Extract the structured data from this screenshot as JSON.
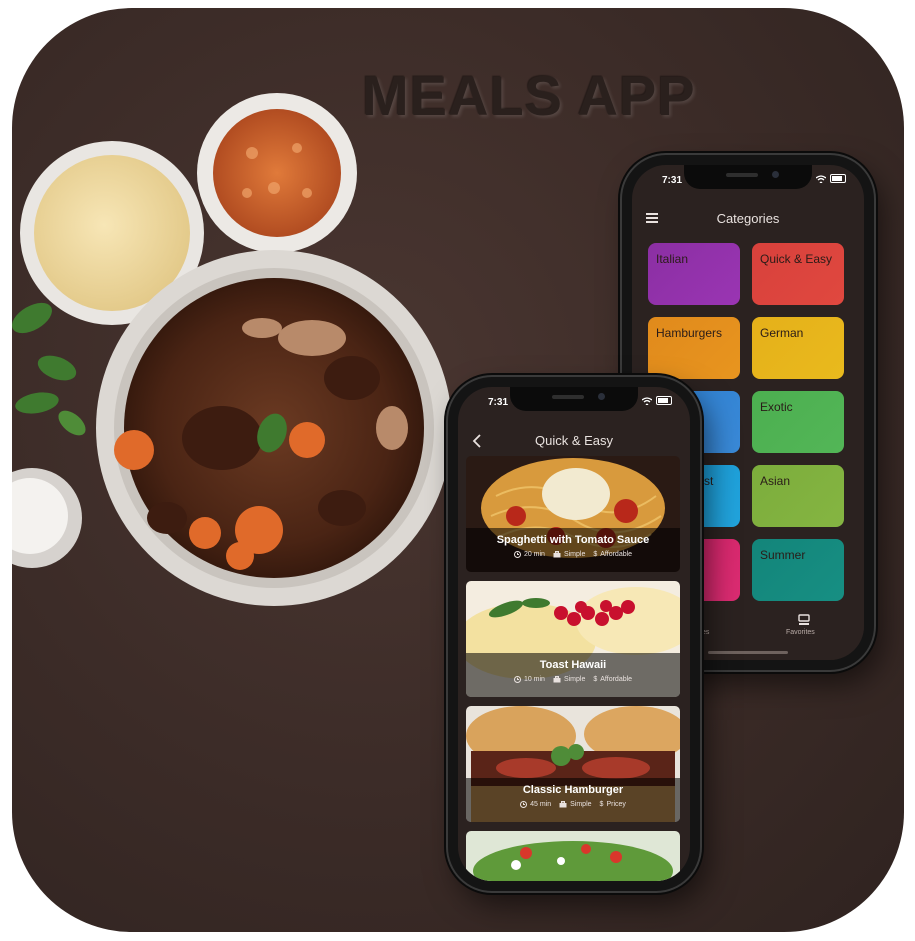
{
  "title": "MEALS APP",
  "categories_screen": {
    "status_time": "7:31",
    "title": "Categories",
    "categories": [
      {
        "label": "Italian",
        "color": "#8b2fa3"
      },
      {
        "label": "Quick & Easy",
        "color": "#d8413c"
      },
      {
        "label": "Hamburgers",
        "color": "#e08a1c"
      },
      {
        "label": "German",
        "color": "#e5b01a"
      },
      {
        "label": "",
        "color": "#2f80d1"
      },
      {
        "label": "Exotic",
        "color": "#4caf50"
      },
      {
        "label": "st",
        "color": "#1a9bd6"
      },
      {
        "label": "Asian",
        "color": "#7cad3c"
      },
      {
        "label": "",
        "color": "#d32469"
      },
      {
        "label": "Summer",
        "color": "#13857a"
      }
    ],
    "tabs": {
      "left_partial": "es",
      "favorites": "Favorites"
    }
  },
  "quick_easy_screen": {
    "status_time": "7:31",
    "title": "Quick & Easy",
    "meals": [
      {
        "title": "Spaghetti with Tomato Sauce",
        "duration": "20 min",
        "complexity": "Simple",
        "affordability": "Affordable"
      },
      {
        "title": "Toast Hawaii",
        "duration": "10 min",
        "complexity": "Simple",
        "affordability": "Affordable"
      },
      {
        "title": "Classic Hamburger",
        "duration": "45 min",
        "complexity": "Simple",
        "affordability": "Pricey"
      }
    ]
  },
  "icons": [
    "menu-icon",
    "back-chevron-icon",
    "clock-icon",
    "briefcase-icon",
    "dollar-icon",
    "wifi-icon",
    "battery-icon",
    "favorites-icon"
  ]
}
